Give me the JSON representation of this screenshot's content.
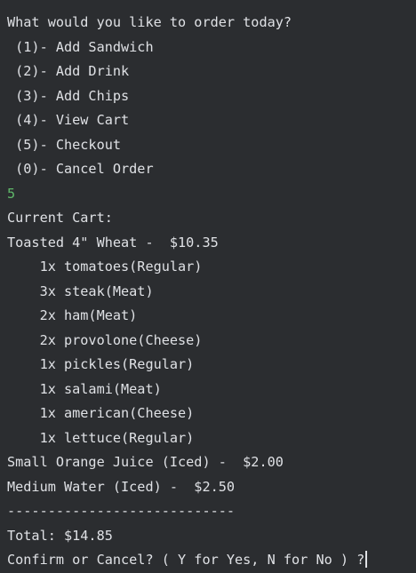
{
  "prompt": "What would you like to order today?",
  "menu": [
    " (1)- Add Sandwich",
    " (2)- Add Drink",
    " (3)- Add Chips",
    " (4)- View Cart",
    " (5)- Checkout",
    " (0)- Cancel Order"
  ],
  "user_input": "5",
  "cart_header": "Current Cart:",
  "sandwich_line": "Toasted 4\" Wheat -  $10.35",
  "toppings": [
    "    1x tomatoes(Regular)",
    "    3x steak(Meat)",
    "    2x ham(Meat)",
    "    2x provolone(Cheese)",
    "    1x pickles(Regular)",
    "    1x salami(Meat)",
    "    1x american(Cheese)",
    "    1x lettuce(Regular)"
  ],
  "drinks": [
    "Small Orange Juice (Iced) -  $2.00",
    "Medium Water (Iced) -  $2.50"
  ],
  "divider": "----------------------------",
  "total": "Total: $14.85",
  "confirm_prompt": "Confirm or Cancel? ( Y for Yes, N for No ) ?",
  "colors": {
    "background": "#2b2d30",
    "text": "#dfe1e5",
    "input_echo": "#5fb86a"
  }
}
